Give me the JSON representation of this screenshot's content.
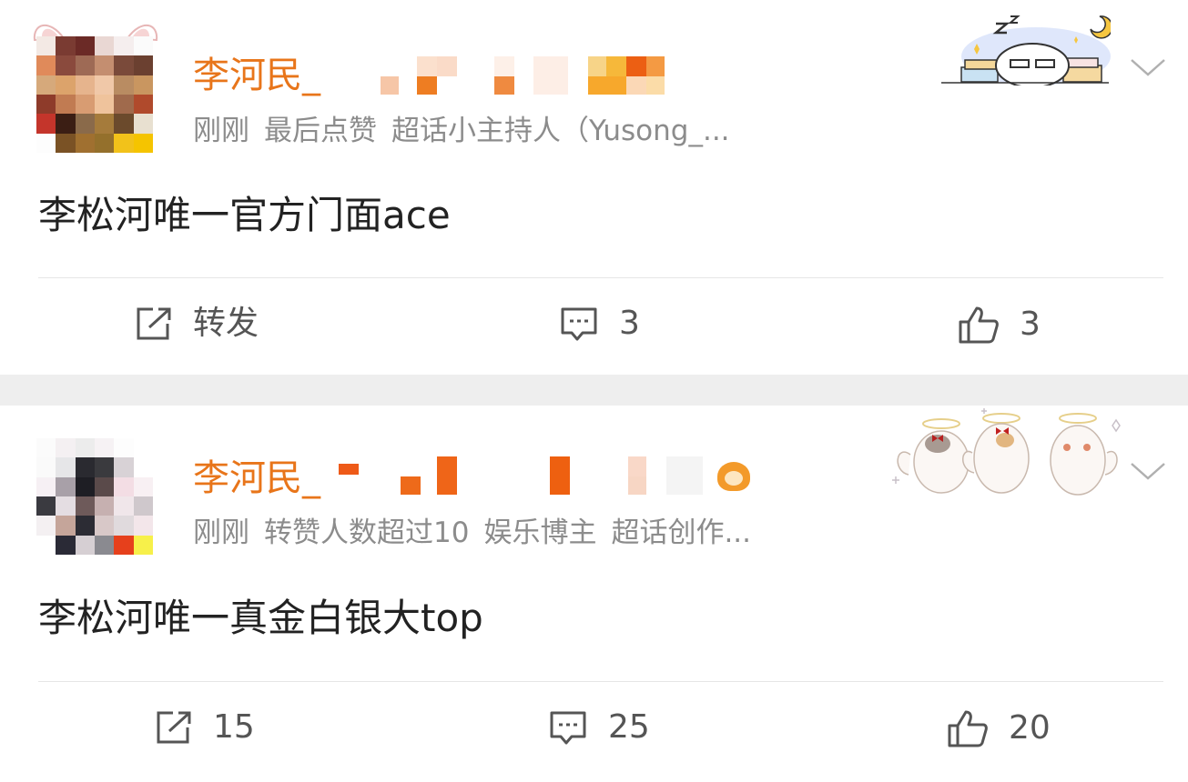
{
  "posts": [
    {
      "username": "李河民_",
      "time": "刚刚",
      "badges": [
        "最后点赞",
        "超话小主持人（Yusong_..."
      ],
      "content": "李松河唯一官方门面ace",
      "actions": {
        "repost": "转发",
        "comment": "3",
        "like": "3"
      }
    },
    {
      "username": "李河民_",
      "time": "刚刚",
      "badges": [
        "转赞人数超过10",
        "娱乐博主",
        "超话创作..."
      ],
      "content": "李松河唯一真金白银大top",
      "actions": {
        "repost": "15",
        "comment": "25",
        "like": "20"
      }
    }
  ],
  "colors": {
    "username": "#e8751a",
    "meta": "#8c8c8c",
    "content": "#222222",
    "separator": "#eeeeee"
  },
  "icons": [
    "avatar",
    "share-icon",
    "comment-icon",
    "like-icon",
    "chevron-down-icon",
    "sticker"
  ]
}
